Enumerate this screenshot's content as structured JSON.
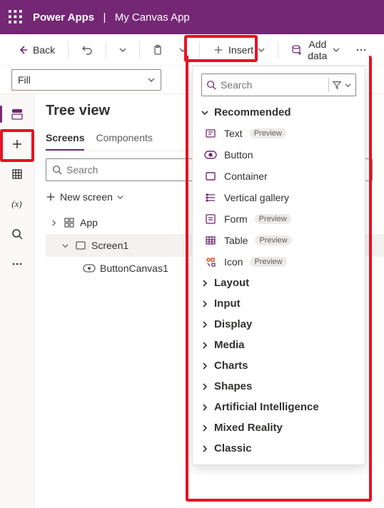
{
  "header": {
    "product": "Power Apps",
    "app": "My Canvas App"
  },
  "toolbar": {
    "back": "Back",
    "insert": "Insert",
    "add_data": "Add data"
  },
  "property_bar": {
    "selected": "Fill"
  },
  "left_rail": {
    "items": [
      "tree-view",
      "insert",
      "data",
      "variables",
      "search",
      "more"
    ]
  },
  "tree": {
    "title": "Tree view",
    "tabs": {
      "screens": "Screens",
      "components": "Components"
    },
    "search_placeholder": "Search",
    "new_screen": "New screen",
    "nodes": {
      "app": "App",
      "screen1": "Screen1",
      "button": "ButtonCanvas1"
    }
  },
  "insert_panel": {
    "search_placeholder": "Search",
    "recommended": {
      "title": "Recommended",
      "items": [
        {
          "label": "Text",
          "preview": true
        },
        {
          "label": "Button",
          "preview": false
        },
        {
          "label": "Container",
          "preview": false
        },
        {
          "label": "Vertical gallery",
          "preview": false
        },
        {
          "label": "Form",
          "preview": true
        },
        {
          "label": "Table",
          "preview": true
        },
        {
          "label": "Icon",
          "preview": true
        }
      ]
    },
    "groups": [
      "Layout",
      "Input",
      "Display",
      "Media",
      "Charts",
      "Shapes",
      "Artificial Intelligence",
      "Mixed Reality",
      "Classic"
    ],
    "preview_label": "Preview"
  }
}
